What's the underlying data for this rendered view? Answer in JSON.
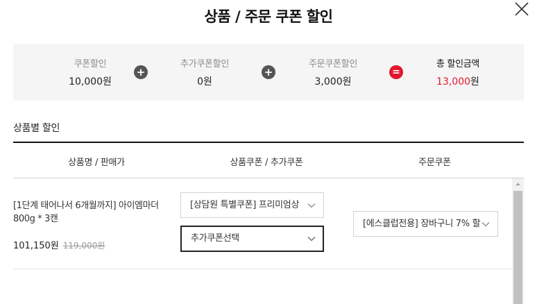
{
  "modal": {
    "title": "상품 / 주문 쿠폰 할인"
  },
  "summary": {
    "product_coupon": {
      "label": "쿠폰할인",
      "value": "10,000원"
    },
    "extra_coupon": {
      "label": "추가쿠폰할인",
      "value": "0원"
    },
    "order_coupon": {
      "label": "주문쿠폰할인",
      "value": "3,000원"
    },
    "total": {
      "label": "총 할인금액",
      "amount": "13,000",
      "unit": "원"
    },
    "ops": {
      "plus": "+",
      "equals": "="
    }
  },
  "section": {
    "title": "상품별 할인"
  },
  "table": {
    "headers": [
      "상품명 / 판매가",
      "상품쿠폰 / 추가쿠폰",
      "주문쿠폰"
    ],
    "rows": [
      {
        "product_name": "[1단계 태어나서 6개월까지] 아이엠마더 800g * 3캔",
        "sale_price": "101,150원",
        "original_price": "119,000원",
        "product_coupon_select": "[상담원 특별쿠폰] 프리미엄상",
        "extra_coupon_select": "추가쿠폰선택",
        "order_coupon_select": "[에스클럽전용] 장바구니 7% 할"
      }
    ]
  },
  "colors": {
    "accent_red": "#e0182d",
    "operator_gray": "#555555",
    "summary_bg": "#f5f5f5"
  },
  "icons": {
    "close": "close-icon",
    "chevron": "chevron-down-icon",
    "scroll_up": "scroll-up-arrow-icon"
  }
}
